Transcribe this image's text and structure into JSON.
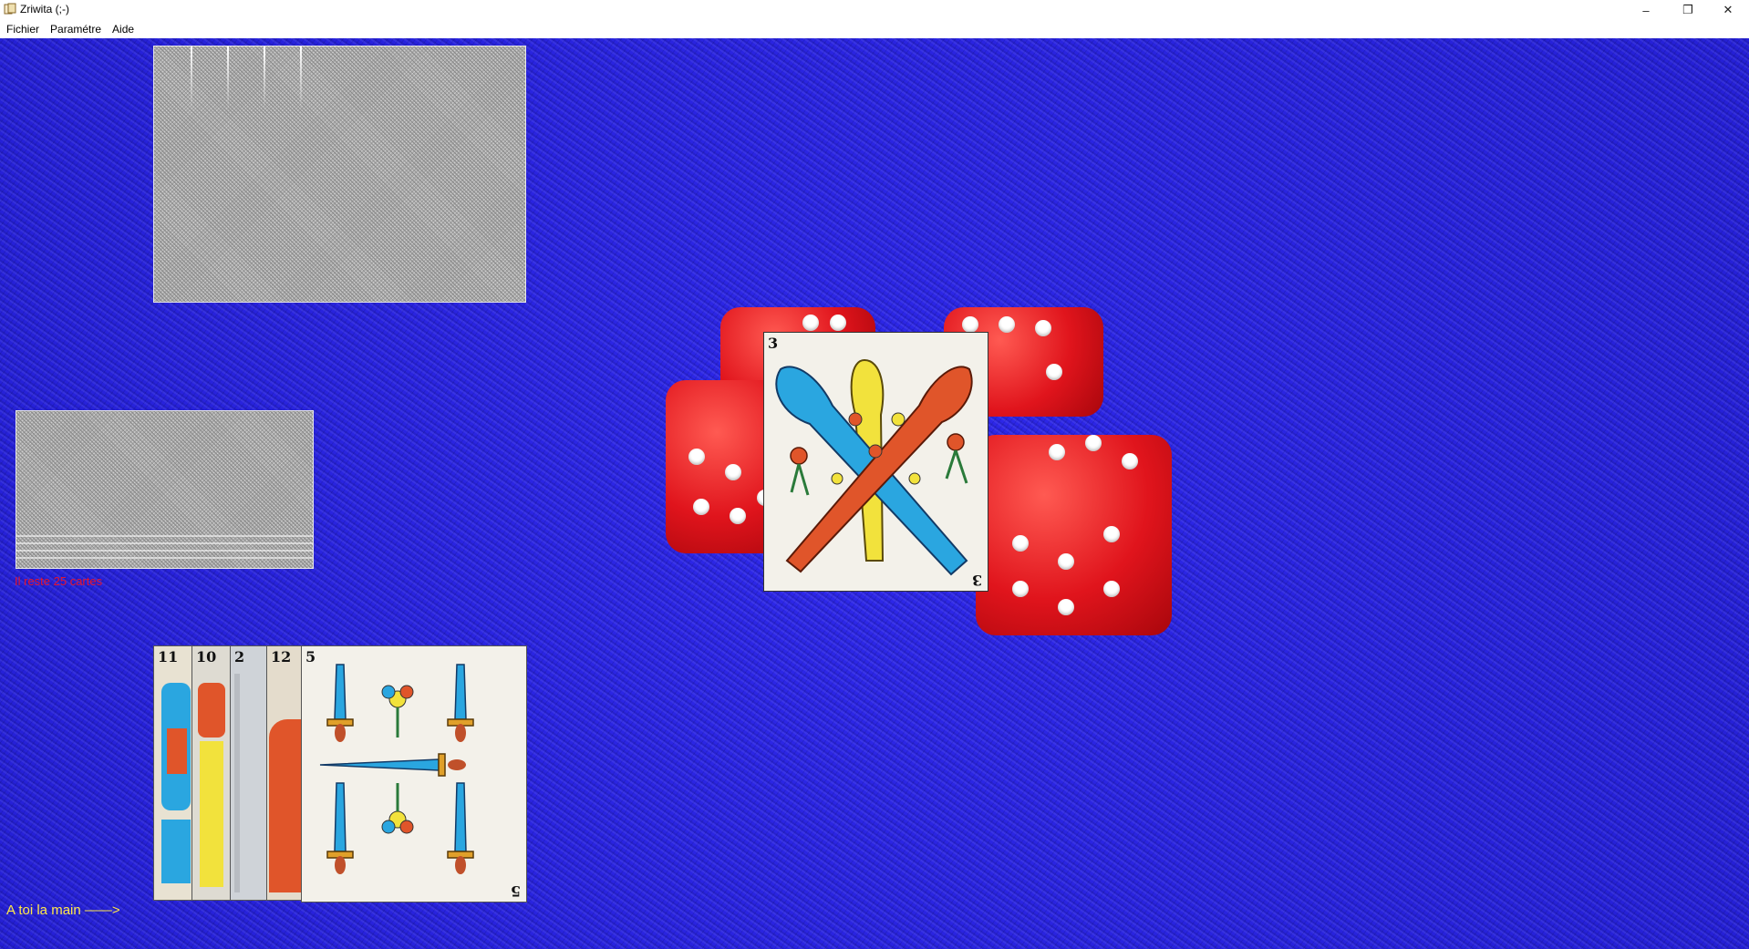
{
  "window": {
    "title": "Zriwita (;-)",
    "controls": {
      "minimize": "–",
      "maximize": "❐",
      "close": "✕"
    }
  },
  "menu": [
    {
      "label": "Fichier"
    },
    {
      "label": "Paramétre"
    },
    {
      "label": "Aide"
    }
  ],
  "table": {
    "felt_color": "#2a24e0",
    "opponent_hand": {
      "cards_shown": 5,
      "face": "down"
    },
    "deck": {
      "face": "down",
      "remaining_text": "Il reste 25 cartes"
    },
    "played_card": {
      "rank": "3",
      "suit": "bastos",
      "suit_colors": [
        "#2aa6e0",
        "#e0552a",
        "#f2e23c"
      ]
    },
    "player_hand": [
      {
        "rank": "11",
        "suit": "copas"
      },
      {
        "rank": "10",
        "suit": "copas"
      },
      {
        "rank": "2",
        "suit": "espadas"
      },
      {
        "rank": "12",
        "suit": "copas"
      },
      {
        "rank": "5",
        "suit": "espadas"
      }
    ],
    "turn_text": "A toi la main ——>"
  },
  "colors": {
    "remaining_text": "#e8142c",
    "turn_text": "#ffe84a",
    "dice": "#e0141c"
  }
}
